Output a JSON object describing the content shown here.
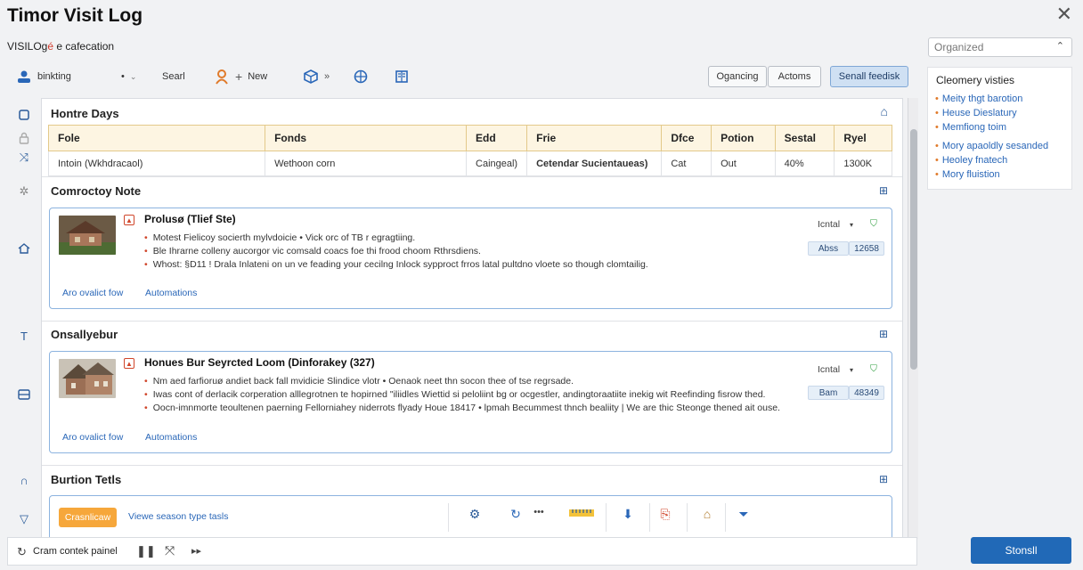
{
  "app": {
    "title": "Timor Visit Log",
    "subtitle_main": "VISILOg",
    "subtitle_mark": "é",
    "subtitle_rest": " e cafecation",
    "close": "✕"
  },
  "organize_select": {
    "value": "Organized",
    "chevron": "⌃"
  },
  "toolbar": {
    "user_label": "binkting",
    "dot_menu": "•",
    "search_label": "Searl",
    "new_label": "New",
    "arrow_label": "»",
    "tab1": "Ogancing",
    "tab2": "Actoms",
    "primary_button": "Senall feedisk"
  },
  "sections": {
    "s1": {
      "title": "Hontre Days",
      "table": {
        "headers": [
          "Fole",
          "Fonds",
          "Edd",
          "Frie",
          "Dfce",
          "Potion",
          "Sestal",
          "Ryel"
        ],
        "rows": [
          [
            "Intoin (Wkhdracaol)",
            "Wethoon corn",
            "Caingeal)",
            "Cetendar Sucientaueas)",
            "Cat",
            "Out",
            "40%",
            "1300K"
          ]
        ]
      }
    },
    "s2": {
      "title": "Comroctoy Note",
      "card": {
        "title": "Prolusø (Tlief Ste)",
        "lines": [
          "Motest Fielicoy socierth mylvdoicie  •  Vick orc of TB  r egragtiing.",
          "Ble Ihrarne colleny aucorgor vic comsald coacs foe thi frood choom Rthrsdiens.",
          "Whost: §D11 ! Drala Inlateni on un ve feading your cecilng Inlock sypproct frros latal pultdno vloete so though clomtailig."
        ],
        "control": "Icntal",
        "pill_a": "Abss",
        "pill_b": "12658",
        "link1": "Aro ovalict fow",
        "link2": "Automations"
      }
    },
    "s3": {
      "title": "Onsallyebur",
      "card": {
        "title": "Honues Bur Seyrcted Loom (Dinforakey (327)",
        "lines": [
          "Nm aed farfioruø andiet back fall mvidicie Slindice vlotr  •  Oenaok neet thn socon thee of tse regrsade.",
          "Iwas cont of derlacik corperation alllegrotnen te hopirned \"iliidles Wiettid si peloliint bg or ocgestler, andingtoraatiite inekig wit Reefinding fisrow thed.",
          "Oocn-imnmorte teoultenen paerning Fellorniahey niderrots flyady Houe 18417  •  lpmah Becummest thnch bealiity  |  We are thic Steonge thened ait ouse."
        ],
        "control": "Icntal",
        "pill_a": "Bam",
        "pill_b": "48349",
        "link1": "Aro ovalict fow",
        "link2": "Automations"
      }
    },
    "s4": {
      "title": "Burtion Tetls",
      "orange_button": "Crasnlicaw",
      "view_label": "Viewe season type tasls",
      "dots": "•••"
    }
  },
  "right_panel": {
    "heading": "Cleomery visties",
    "items": [
      "Meity thgt barotion",
      "Heuse Dieslatury",
      "Memfiong toim",
      "Mory apaoldly sesanded",
      "Heoley fnatech",
      "Mory fluistion"
    ]
  },
  "bottom": {
    "label": "Cram contek painel",
    "submit": "Stonsll"
  },
  "colors": {
    "accent": "#2169b7",
    "flag": "#d0452a",
    "orange": "#f6a73b",
    "table_header_bg": "#fdf5e2"
  }
}
